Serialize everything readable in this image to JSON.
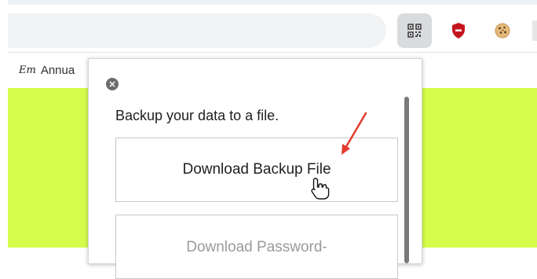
{
  "bookmarks": {
    "items": [
      {
        "label": "Annua",
        "favicon": "Em"
      }
    ]
  },
  "extensions": [
    {
      "name": "qr-code-icon"
    },
    {
      "name": "shield-icon",
      "color": "#c4161c"
    },
    {
      "name": "cookie-icon"
    }
  ],
  "popup": {
    "close_label": "×",
    "heading": "Backup your data to a file.",
    "buttons": {
      "download_backup": "Download Backup File",
      "download_password": "Download Password-"
    }
  },
  "colors": {
    "page_background": "#d4fc4a",
    "annotation_arrow": "#e23b2e"
  }
}
